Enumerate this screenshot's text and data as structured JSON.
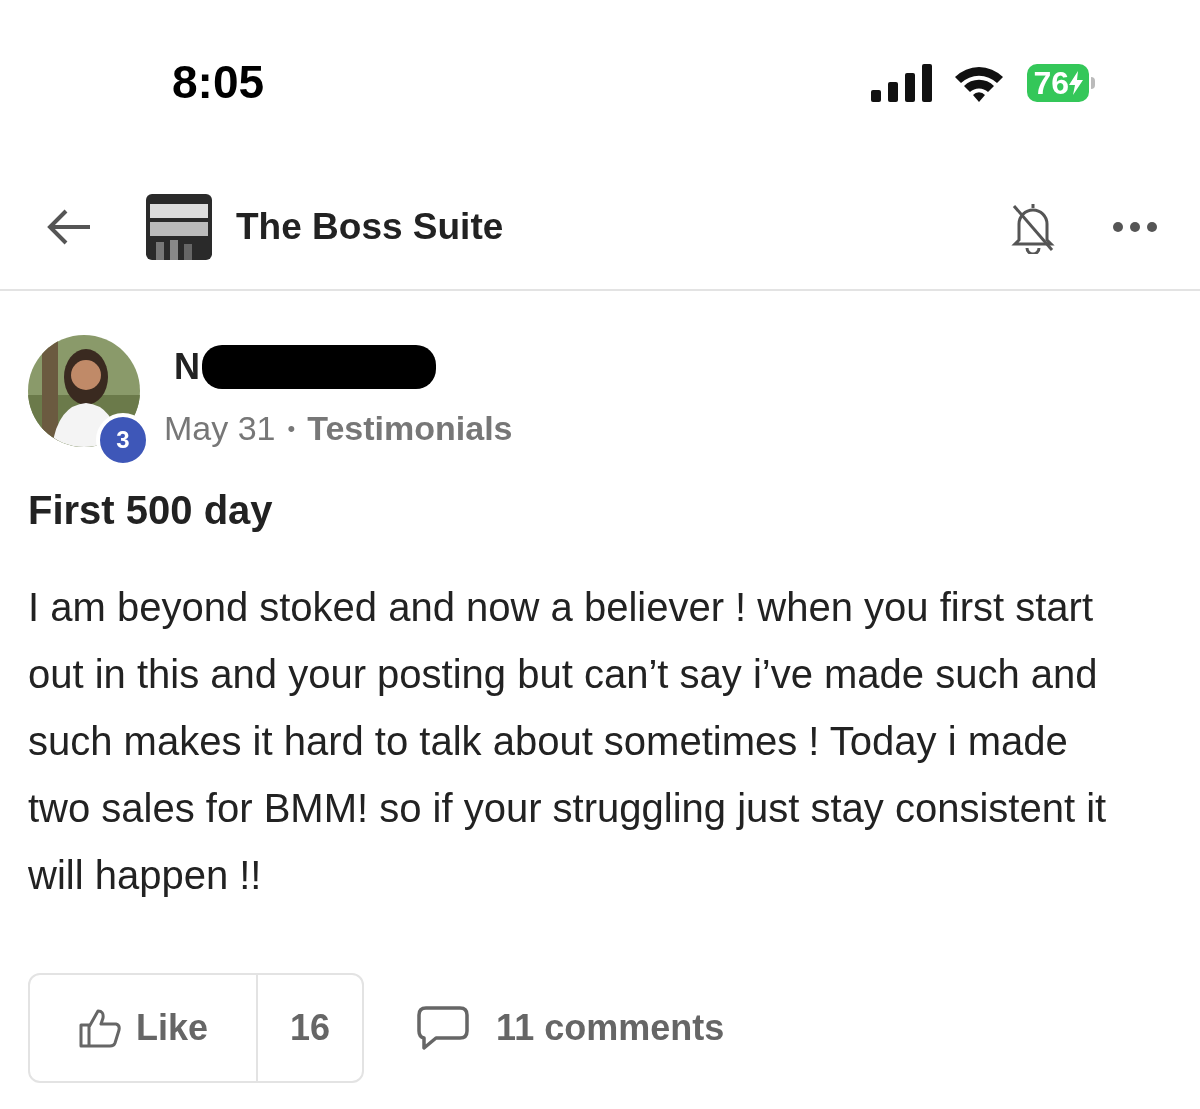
{
  "status_bar": {
    "time": "8:05",
    "battery": "76"
  },
  "header": {
    "title": "The Boss Suite"
  },
  "post": {
    "author": "N",
    "level_badge": "3",
    "date": "May 31",
    "separator": "•",
    "category": "Testimonials",
    "title": "First 500 day",
    "body": "I am beyond stoked and now a believer ! when you first start out in this and your posting but can’t say i’ve made such and such makes it hard to talk about sometimes ! Today i made two sales for BMM! so if your struggling just stay consistent it will happen !!"
  },
  "actions": {
    "like_label": "Like",
    "like_count": "16",
    "comments": "11 comments"
  }
}
